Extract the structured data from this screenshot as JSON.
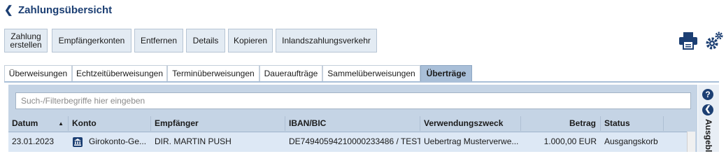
{
  "header": {
    "title": "Zahlungsübersicht"
  },
  "toolbar": {
    "buttons": [
      {
        "line1": "Zahlung",
        "line2": "erstellen"
      },
      {
        "label": "Empfängerkonten"
      },
      {
        "label": "Entfernen"
      },
      {
        "label": "Details"
      },
      {
        "label": "Kopieren"
      },
      {
        "label": "Inlandszahlungsverkehr"
      }
    ]
  },
  "tabs": [
    {
      "label": "Überweisungen"
    },
    {
      "label": "Echtzeitüberweisungen"
    },
    {
      "label": "Terminüberweisungen"
    },
    {
      "label": "Daueraufträge"
    },
    {
      "label": "Sammelüberweisungen"
    },
    {
      "label": "Überträge",
      "active": true
    }
  ],
  "search": {
    "placeholder": "Such-/Filterbegriffe hier eingeben"
  },
  "table": {
    "columns": [
      "Datum",
      "Konto",
      "Empfänger",
      "IBAN/BIC",
      "Verwendungszweck",
      "Betrag",
      "Status"
    ],
    "sort_indicator": "▲",
    "rows": [
      {
        "datum": "23.01.2023",
        "konto": "Girokonto-Ge...",
        "empfaenger": "DIR. MARTIN PUSH",
        "iban": "DE74940594210000233486 / TEST...",
        "zweck": "Uebertrag Musterverwe...",
        "betrag": "1.000,00 EUR",
        "status": "Ausgangskorb"
      }
    ]
  },
  "side_panel": {
    "label": "Ausgeblendet"
  },
  "icons": {
    "back": "chevron-left-icon",
    "print": "printer-icon",
    "settings": "gears-icon",
    "help": "help-icon",
    "collapse": "chevron-left-circle-icon",
    "bank": "bank-icon"
  },
  "colors": {
    "brand": "#1c3f73",
    "tab_active": "#a9bfd8",
    "row_selected": "#dde8f5"
  }
}
